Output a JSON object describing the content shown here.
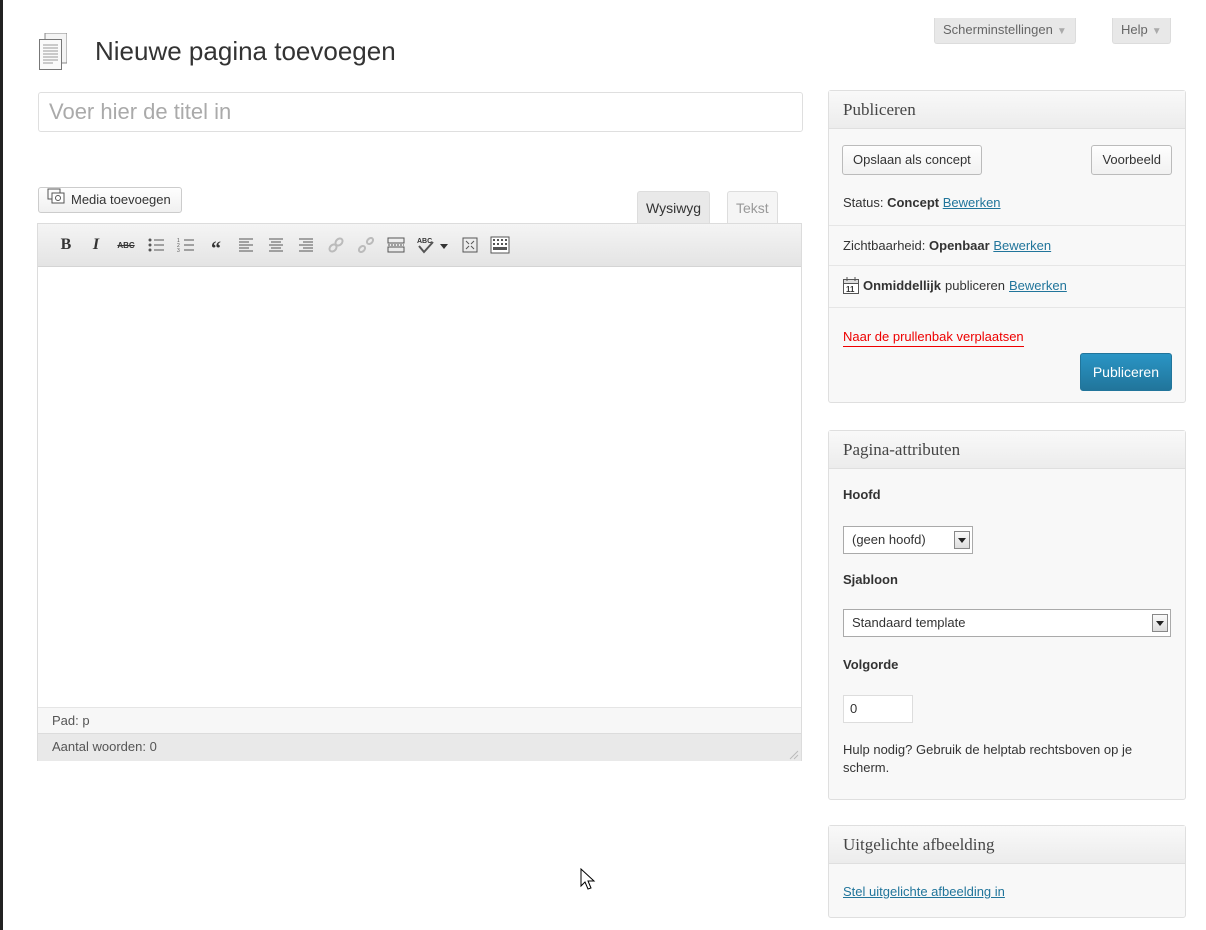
{
  "screen_options": {
    "label": "Scherminstellingen",
    "help": "Help"
  },
  "page": {
    "title": "Nieuwe pagina toevoegen"
  },
  "title_input": {
    "placeholder": "Voer hier de titel in"
  },
  "media": {
    "button": "Media toevoegen"
  },
  "editor": {
    "tabs": [
      "Wysiwyg",
      "Tekst"
    ],
    "active_tab": "Wysiwyg",
    "toolbar_icons": [
      "bold-icon",
      "italic-icon",
      "strikethrough-icon",
      "bullet-list-icon",
      "numbered-list-icon",
      "blockquote-icon",
      "align-left-icon",
      "align-center-icon",
      "align-right-icon",
      "link-icon",
      "unlink-icon",
      "more-tag-icon",
      "spellcheck-icon",
      "fullscreen-icon",
      "kitchen-sink-icon"
    ],
    "path": "Pad: p",
    "word_count": "Aantal woorden: 0"
  },
  "publish": {
    "heading": "Publiceren",
    "save_draft": "Opslaan als concept",
    "preview": "Voorbeeld",
    "status_label": "Status:",
    "status_value": "Concept",
    "visibility_label": "Zichtbaarheid:",
    "visibility_value": "Openbaar",
    "schedule_bold": "Onmiddellijk",
    "schedule_rest": "publiceren",
    "edit_link": "Bewerken",
    "trash": "Naar de prullenbak verplaatsen",
    "publish_button": "Publiceren"
  },
  "attributes": {
    "heading": "Pagina-attributen",
    "parent_label": "Hoofd",
    "parent_value": "(geen hoofd)",
    "template_label": "Sjabloon",
    "template_value": "Standaard template",
    "order_label": "Volgorde",
    "order_value": "0",
    "help_text": "Hulp nodig? Gebruik de helptab rechtsboven op je scherm."
  },
  "featured": {
    "heading": "Uitgelichte afbeelding",
    "set_link": "Stel uitgelichte afbeelding in"
  },
  "colors": {
    "link": "#21759b",
    "trash": "#ee0000",
    "primary": "#21759b"
  }
}
